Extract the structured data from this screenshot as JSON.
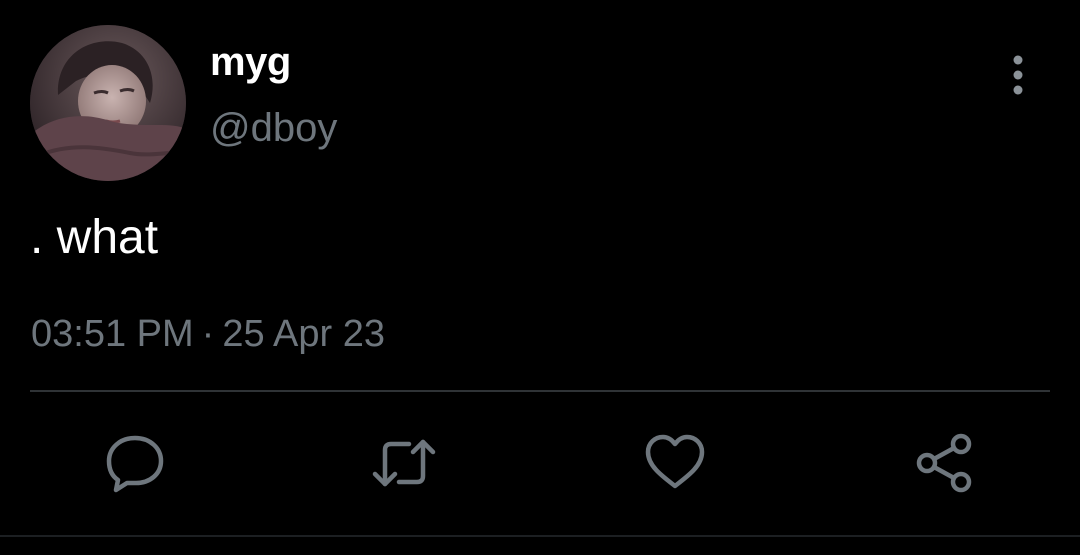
{
  "tweet": {
    "display_name": "myg",
    "handle": "@dboy",
    "text": ". what",
    "time": "03:51 PM",
    "separator": "·",
    "date": "25 Apr 23"
  },
  "icons": {
    "more": "more-vertical-icon",
    "reply": "reply-icon",
    "retweet": "retweet-icon",
    "like": "heart-icon",
    "share": "share-icon"
  },
  "colors": {
    "background": "#000000",
    "primary_text": "#ffffff",
    "secondary_text": "#6e767d",
    "icon": "#6e767d",
    "divider": "#2f3336"
  }
}
